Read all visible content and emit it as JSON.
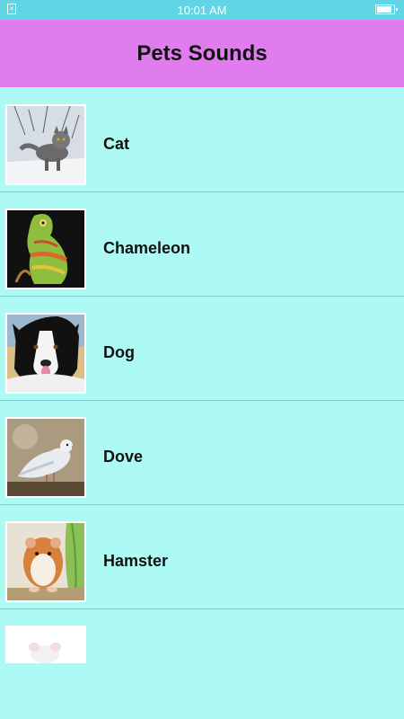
{
  "status_bar": {
    "time": "10:01 AM",
    "battery_level": 0.9,
    "notification_icon": "close-box-icon"
  },
  "header": {
    "title": "Pets Sounds"
  },
  "pets": [
    {
      "name": "Cat",
      "thumb_icon": "cat-photo"
    },
    {
      "name": "Chameleon",
      "thumb_icon": "chameleon-photo"
    },
    {
      "name": "Dog",
      "thumb_icon": "dog-photo"
    },
    {
      "name": "Dove",
      "thumb_icon": "dove-photo"
    },
    {
      "name": "Hamster",
      "thumb_icon": "hamster-photo"
    },
    {
      "name": "",
      "thumb_icon": "mouse-photo"
    }
  ],
  "colors": {
    "status_bar": "#5fd5e6",
    "header": "#e07cee",
    "list_background": "#adfaf4",
    "divider": "#86c9c5"
  }
}
